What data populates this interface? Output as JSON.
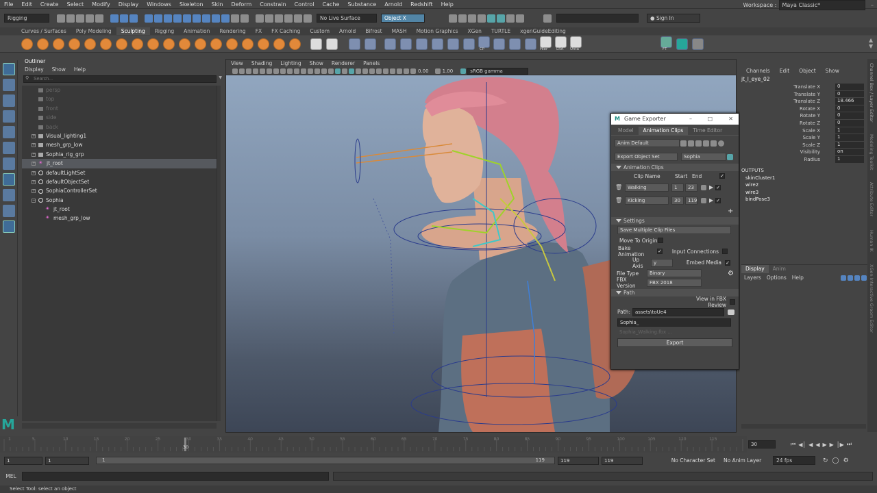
{
  "menubar": {
    "items": [
      "File",
      "Edit",
      "Create",
      "Select",
      "Modify",
      "Display",
      "Windows",
      "Skeleton",
      "Skin",
      "Deform",
      "Constrain",
      "Control",
      "Cache",
      "Substance",
      "Arnold",
      "Redshift",
      "Help"
    ]
  },
  "workspace": {
    "label": "Workspace :",
    "value": "Maya Classic*"
  },
  "statusline": {
    "menuset": "Rigging",
    "live_surface": "No Live Surface",
    "object_mode": "Object X",
    "sign_in": "Sign In"
  },
  "shelf": {
    "tabs": [
      "Curves / Surfaces",
      "Poly Modeling",
      "Sculpting",
      "Rigging",
      "Animation",
      "Rendering",
      "FX",
      "FX Caching",
      "Custom",
      "Arnold",
      "Bifrost",
      "MASH",
      "Motion Graphics",
      "XGen",
      "TURTLE",
      "xgenGuideEditing"
    ],
    "active_tab": "Sculpting",
    "labels": [
      "CP",
      "Hier",
      "LRA",
      "Unta",
      "FT"
    ]
  },
  "outliner": {
    "title": "Outliner",
    "menu": [
      "Display",
      "Show",
      "Help"
    ],
    "search_placeholder": "Search...",
    "items": [
      {
        "label": "persp",
        "icon": "camera",
        "dim": true
      },
      {
        "label": "top",
        "icon": "camera",
        "dim": true
      },
      {
        "label": "front",
        "icon": "camera",
        "dim": true
      },
      {
        "label": "side",
        "icon": "camera",
        "dim": true
      },
      {
        "label": "back",
        "icon": "camera",
        "dim": true
      },
      {
        "label": "Visual_lighting1",
        "icon": "transform"
      },
      {
        "label": "mesh_grp_low",
        "icon": "transform"
      },
      {
        "label": "Sophia_rig_grp",
        "icon": "transform"
      },
      {
        "label": "jt_root",
        "icon": "joint",
        "selected": true
      },
      {
        "label": "defaultLightSet",
        "icon": "set"
      },
      {
        "label": "defaultObjectSet",
        "icon": "set"
      },
      {
        "label": "SophiaControllerSet",
        "icon": "set"
      },
      {
        "label": "Sophia",
        "icon": "set"
      },
      {
        "label": "jt_root",
        "icon": "joint",
        "child": true
      },
      {
        "label": "mesh_grp_low",
        "icon": "joint",
        "child": true
      }
    ]
  },
  "viewport": {
    "menu": [
      "View",
      "Shading",
      "Lighting",
      "Show",
      "Renderer",
      "Panels"
    ],
    "exposure": "0.00",
    "gamma": "1.00",
    "color_space": "sRGB gamma"
  },
  "game_exporter": {
    "title": "Game Exporter",
    "tabs": [
      "Model",
      "Animation Clips",
      "Time Editor"
    ],
    "active_tab": "Animation Clips",
    "preset": "Anim Default",
    "export_mode": "Export Object Set",
    "object_set": "Sophia",
    "clips_section": "Animation Clips",
    "clip_headers": [
      "Clip Name",
      "Start",
      "End"
    ],
    "clips": [
      {
        "name": "Walking",
        "start": "1",
        "end": "23"
      },
      {
        "name": "Kicking",
        "start": "30",
        "end": "119"
      }
    ],
    "settings_section": "Settings",
    "multiple_clips": "Save Multiple Clip Files",
    "move_to_origin": "Move To Origin",
    "bake_animation": "Bake Animation",
    "input_connections": "Input Connections",
    "up_axis_label": "Up Axis",
    "up_axis": "y",
    "embed_media": "Embed Media",
    "file_type_label": "File Type",
    "file_type": "Binary",
    "fbx_version_label": "FBX Version",
    "fbx_version": "FBX 2018",
    "path_section": "Path",
    "view_in_fbx": "View in FBX Review",
    "path_label": "Path:",
    "path": "assets\\toUe4",
    "filename": "Sophia_",
    "preview_name": "Sophia_Walking.fbx ...",
    "export_button": "Export"
  },
  "channel_box": {
    "menu": [
      "Channels",
      "Edit",
      "Object",
      "Show"
    ],
    "node": "jt_l_eye_02",
    "channels": [
      {
        "name": "Translate X",
        "value": "0"
      },
      {
        "name": "Translate Y",
        "value": "0"
      },
      {
        "name": "Translate Z",
        "value": "18.466"
      },
      {
        "name": "Rotate X",
        "value": "0"
      },
      {
        "name": "Rotate Y",
        "value": "0"
      },
      {
        "name": "Rotate Z",
        "value": "0"
      },
      {
        "name": "Scale X",
        "value": "1"
      },
      {
        "name": "Scale Y",
        "value": "1"
      },
      {
        "name": "Scale Z",
        "value": "1"
      },
      {
        "name": "Visibility",
        "value": "on"
      },
      {
        "name": "Radius",
        "value": "1"
      }
    ],
    "outputs_label": "OUTPUTS",
    "outputs": [
      "skinCluster1",
      "wire2",
      "wire3",
      "bindPose3"
    ],
    "layer_tabs": [
      "Display",
      "Anim"
    ],
    "layer_menu": [
      "Layers",
      "Options",
      "Help"
    ]
  },
  "side_tabs": [
    "Channel Box / Layer Editor",
    "Modeling Toolkit",
    "Attribute Editor",
    "Human IK",
    "XGen Interactive Groom Editor"
  ],
  "timeline": {
    "ticks": [
      "1",
      "5",
      "10",
      "15",
      "20",
      "25",
      "30",
      "35",
      "40",
      "45",
      "50",
      "55",
      "60",
      "65",
      "70",
      "75",
      "80",
      "85",
      "90",
      "95",
      "100",
      "105",
      "110",
      "115"
    ],
    "current_frame": "30",
    "current_frame_field": "30",
    "current_frame_fraction": 0.2448
  },
  "range": {
    "start": "1",
    "inner_start": "1",
    "slider_start": "1",
    "slider_end": "119",
    "inner_end": "119",
    "end": "119",
    "character_set": "No Character Set",
    "anim_layer": "No Anim Layer",
    "fps": "24 fps"
  },
  "cmdline": {
    "label": "MEL"
  },
  "helpline": {
    "text": "Select Tool: select an object"
  },
  "colors": {
    "accent": "#5285a6",
    "shelf_orange": "#e2893a",
    "logo": "#26a69a"
  }
}
